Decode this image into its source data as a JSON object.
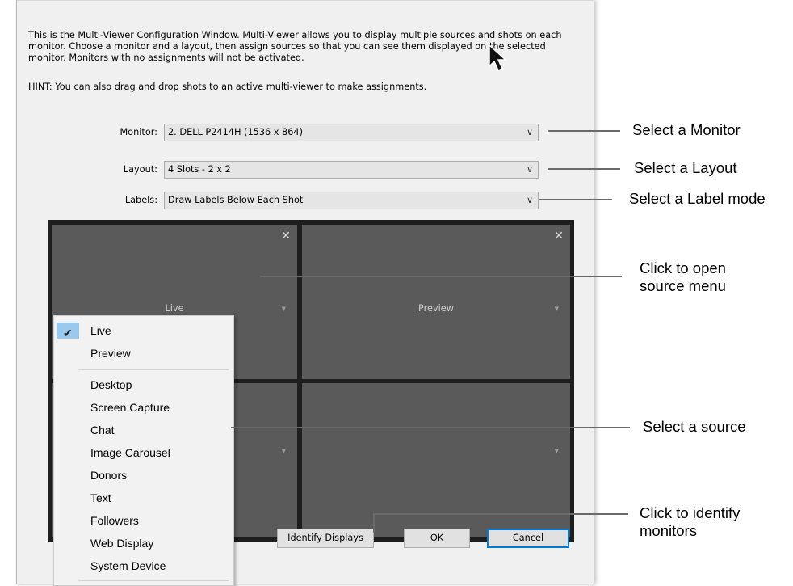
{
  "dialog": {
    "description": "This is the Multi-Viewer Configuration Window. Multi-Viewer allows you to display multiple sources and shots on each monitor. Choose a monitor and a layout, then assign sources so that you can see them displayed on the selected monitor. Monitors with no assignments will not be activated.",
    "hint": "HINT: You can also drag and drop shots to an active multi-viewer to make assignments.",
    "monitor": {
      "label": "Monitor:",
      "value": "2. DELL P2414H (1536 x 864)"
    },
    "layout": {
      "label": "Layout:",
      "value": "4 Slots - 2 x 2"
    },
    "labels": {
      "label": "Labels:",
      "value": "Draw Labels Below Each Shot"
    },
    "slots": [
      {
        "label": "Live"
      },
      {
        "label": "Preview"
      }
    ],
    "buttons": {
      "identify": "Identify Displays",
      "ok": "OK",
      "cancel": "Cancel"
    }
  },
  "source_menu": {
    "checked": "Live",
    "group1": [
      "Live",
      "Preview"
    ],
    "group2": [
      "Desktop",
      "Screen Capture",
      "Chat",
      "Image Carousel",
      "Donors",
      "Text",
      "Followers",
      "Web Display",
      "System Device"
    ]
  },
  "callouts": {
    "monitor": "Select a Monitor",
    "layout": "Select a Layout",
    "labels": "Select a Label mode",
    "source_menu_1": "Click to open",
    "source_menu_2": "source menu",
    "source": "Select a source",
    "identify_1": "Click to identify",
    "identify_2": "monitors"
  },
  "icons": {
    "close": "close-icon",
    "dropdown": "chevron-down-icon",
    "check": "checkmark-icon",
    "cursor": "mouse-pointer-icon"
  }
}
